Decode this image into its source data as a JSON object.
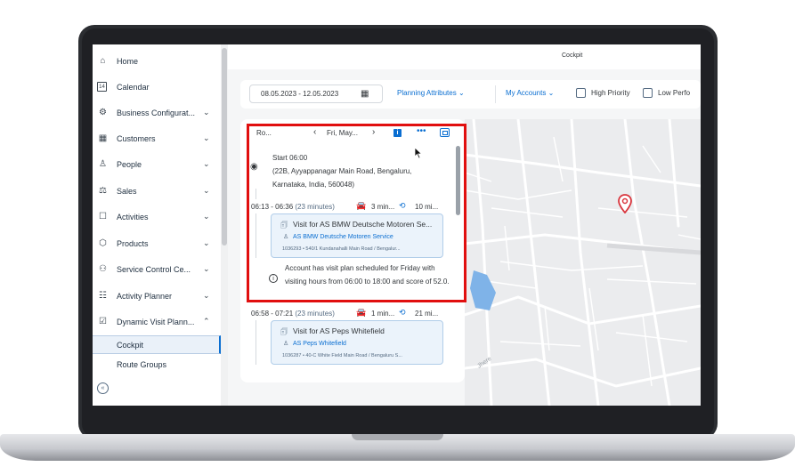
{
  "app": {
    "page_title": "Cockpit"
  },
  "sidebar": {
    "items": [
      {
        "label": "Home",
        "icon": "home-icon",
        "glyph": "⌂",
        "expandable": false
      },
      {
        "label": "Calendar",
        "icon": "calendar-icon",
        "glyph": "14",
        "expandable": false
      },
      {
        "label": "Business Configurat...",
        "icon": "business-config-icon",
        "glyph": "⚙",
        "expandable": true
      },
      {
        "label": "Customers",
        "icon": "customers-icon",
        "glyph": "▦",
        "expandable": true
      },
      {
        "label": "People",
        "icon": "people-icon",
        "glyph": "♙",
        "expandable": true
      },
      {
        "label": "Sales",
        "icon": "sales-icon",
        "glyph": "⚖",
        "expandable": true
      },
      {
        "label": "Activities",
        "icon": "activities-icon",
        "glyph": "☐",
        "expandable": true
      },
      {
        "label": "Products",
        "icon": "products-icon",
        "glyph": "⬡",
        "expandable": true
      },
      {
        "label": "Service Control Ce...",
        "icon": "service-control-icon",
        "glyph": "⚇",
        "expandable": true
      },
      {
        "label": "Activity Planner",
        "icon": "activity-planner-icon",
        "glyph": "☷",
        "expandable": true
      },
      {
        "label": "Dynamic Visit Plann...",
        "icon": "dynamic-visit-icon",
        "glyph": "☑",
        "expandable": true,
        "expanded": true
      }
    ],
    "sub_items": [
      {
        "label": "Cockpit",
        "active": true
      },
      {
        "label": "Route Groups",
        "active": false
      }
    ],
    "collapse_glyph": "«"
  },
  "filters": {
    "date_range": "08.05.2023 - 12.05.2023",
    "planning_attributes": "Planning Attributes",
    "my_accounts": "My Accounts",
    "high_priority": "High Priority",
    "low_performance": "Low Perfo"
  },
  "route": {
    "title": "Ro...",
    "day": "Fri, May...",
    "start_label": "Start 06:00",
    "start_address": "(22B, Ayyappanagar Main Road, Bengaluru, Karnataka, India, 560048)",
    "visits": [
      {
        "time": "06:13 - 06:36",
        "duration": "(23 minutes)",
        "drive": "3 min...",
        "travel": "10 mi...",
        "title": "Visit for AS BMW Deutsche Motoren Se...",
        "account": "AS BMW Deutsche Motoren Service",
        "address": "1036293 • 540/1 Kundanahalli Main Road / Bengalur..."
      },
      {
        "time": "06:58 - 07:21",
        "duration": "(23 minutes)",
        "drive": "1 min...",
        "travel": "21 mi...",
        "title": "Visit for AS Peps Whitefield",
        "account": "AS Peps Whitefield",
        "address": "1036287 • 40-C White Field Main Road / Bengaluru S..."
      }
    ],
    "notice": "Account has visit plan scheduled for Friday with visiting hours from 06:00 to 18:00 and score of 52.0."
  },
  "map": {
    "street_label": "Jhere"
  },
  "colors": {
    "accent": "#0a6ed1",
    "highlight": "#e10f0f",
    "pin": "#d9363e",
    "water": "#7fb3e8"
  }
}
